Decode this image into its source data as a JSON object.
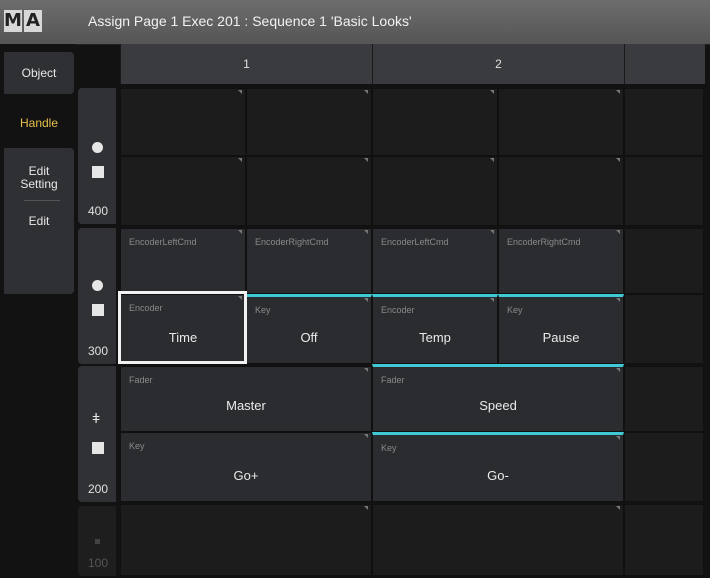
{
  "title": {
    "logo_letters": [
      "M",
      "A"
    ],
    "text": "Assign Page 1 Exec 201 : Sequence 1 'Basic Looks'"
  },
  "sidebar": {
    "object": "Object",
    "handle": "Handle",
    "edit_setting": "Edit\nSetting",
    "edit": "Edit"
  },
  "columns": [
    "1",
    "2"
  ],
  "rows": {
    "r400": "400",
    "r300": "300",
    "r200": "200",
    "r100": "100"
  },
  "cells": {
    "c300a1": {
      "label": "EncoderLeftCmd",
      "value": ""
    },
    "c300a2": {
      "label": "EncoderRightCmd",
      "value": ""
    },
    "c300a3": {
      "label": "EncoderLeftCmd",
      "value": ""
    },
    "c300a4": {
      "label": "EncoderRightCmd",
      "value": ""
    },
    "c300b1": {
      "label": "Encoder",
      "value": "Time"
    },
    "c300b2": {
      "label": "Key",
      "value": "Off"
    },
    "c300b3": {
      "label": "Encoder",
      "value": "Temp"
    },
    "c300b4": {
      "label": "Key",
      "value": "Pause"
    },
    "c200a1": {
      "label": "Fader",
      "value": "Master"
    },
    "c200a2": {
      "label": "Fader",
      "value": "Speed"
    },
    "c200b1": {
      "label": "Key",
      "value": "Go+"
    },
    "c200b2": {
      "label": "Key",
      "value": "Go-"
    }
  },
  "colors": {
    "accent_cyan": "#3fc9d4",
    "handle_active": "#e6c04a"
  }
}
